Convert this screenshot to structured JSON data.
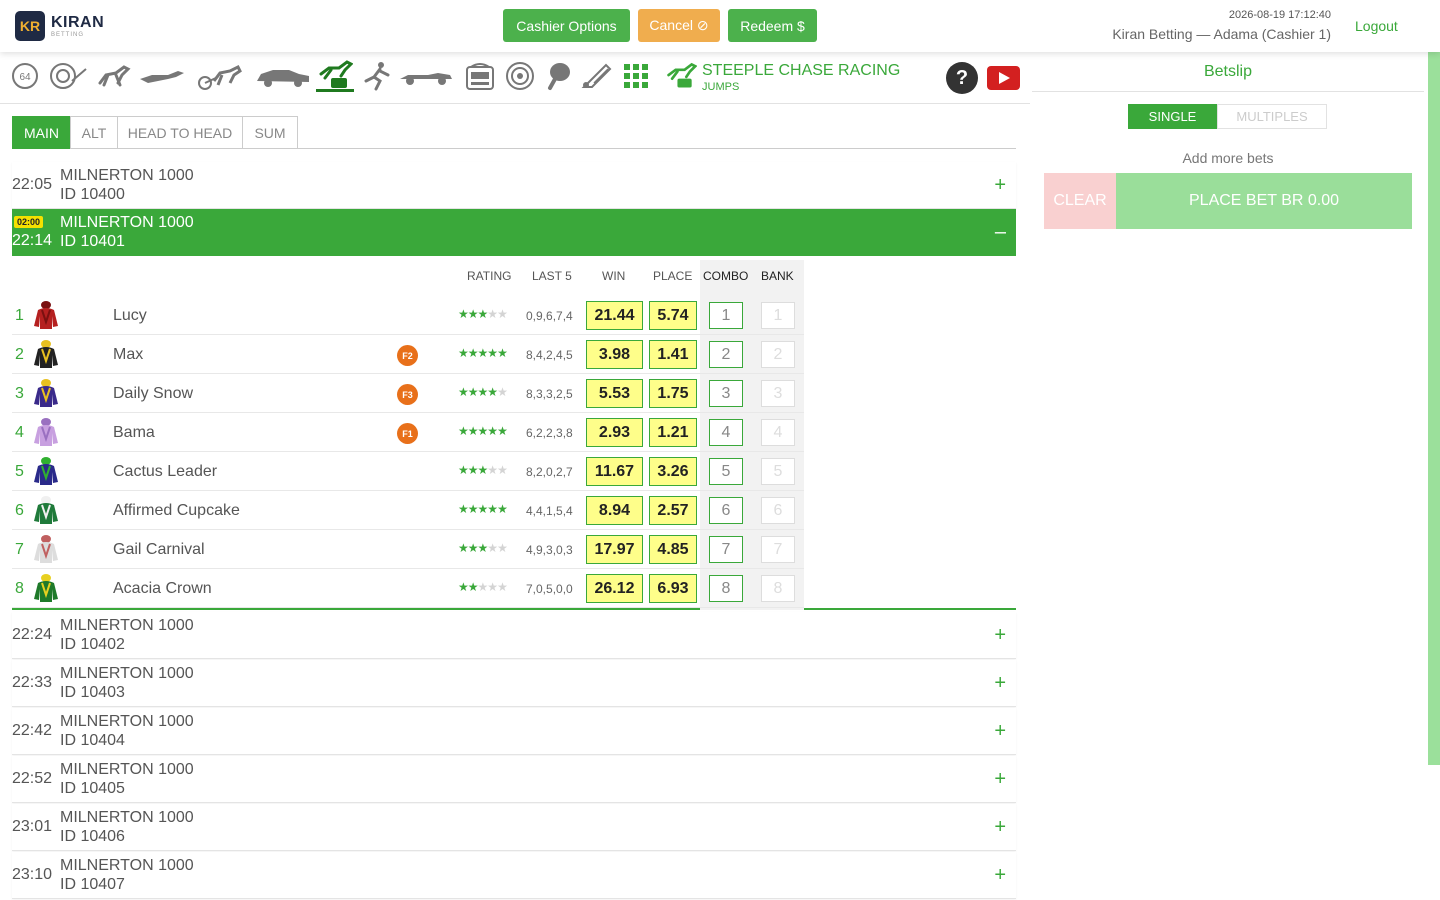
{
  "brand": {
    "badge": "KR",
    "name": "KIRAN",
    "sub": "BETTING"
  },
  "header": {
    "cashier_label": "Cashier Options",
    "cancel_label": "Cancel ⊘",
    "redeem_label": "Redeem $",
    "datetime": "2026-08-19 17:12:40",
    "user": "Kiran Betting — Adama (Cashier 1)",
    "logout_label": "Logout"
  },
  "sports": {
    "icons": [
      "keno-64-icon",
      "spin-wheel-icon",
      "horse-racing-icon",
      "dog-racing-icon",
      "harness-racing-icon",
      "motor-racing-icon",
      "steeple-chase-icon",
      "speed-skating-icon",
      "f1-racing-icon",
      "slot-machine-icon",
      "roulette-icon",
      "table-tennis-icon",
      "badminton-icon",
      "grid-icon"
    ],
    "active_title": "STEEPLE CHASE RACING",
    "active_sub": "JUMPS"
  },
  "tabs": [
    "MAIN",
    "ALT",
    "HEAD TO HEAD",
    "SUM"
  ],
  "races": [
    {
      "time": "22:05",
      "name": "MILNERTON 1000",
      "id": "ID 10400"
    },
    {
      "time": "22:14",
      "name": "MILNERTON 1000",
      "id": "ID 10401",
      "countdown": "02:00"
    },
    {
      "time": "22:24",
      "name": "MILNERTON 1000",
      "id": "ID 10402"
    },
    {
      "time": "22:33",
      "name": "MILNERTON 1000",
      "id": "ID 10403"
    },
    {
      "time": "22:42",
      "name": "MILNERTON 1000",
      "id": "ID 10404"
    },
    {
      "time": "22:52",
      "name": "MILNERTON 1000",
      "id": "ID 10405"
    },
    {
      "time": "23:01",
      "name": "MILNERTON 1000",
      "id": "ID 10406"
    },
    {
      "time": "23:10",
      "name": "MILNERTON 1000",
      "id": "ID 10407"
    }
  ],
  "expanded": {
    "columns": {
      "rating": "RATING",
      "last5": "LAST 5",
      "win": "WIN",
      "place": "PLACE",
      "combo": "COMBO",
      "bank": "BANK"
    },
    "runners": [
      {
        "num": "1",
        "name": "Lucy",
        "fav": "",
        "rating": 3,
        "last5": "0,9,6,7,4",
        "win": "21.44",
        "place": "5.74",
        "silk": [
          "#b52020",
          "#7a1010"
        ]
      },
      {
        "num": "2",
        "name": "Max",
        "fav": "F2",
        "rating": 5,
        "last5": "8,4,2,4,5",
        "win": "3.98",
        "place": "1.41",
        "silk": [
          "#222222",
          "#e8c020"
        ]
      },
      {
        "num": "3",
        "name": "Daily Snow",
        "fav": "F3",
        "rating": 4,
        "last5": "8,3,3,2,5",
        "win": "5.53",
        "place": "1.75",
        "silk": [
          "#3a2a8a",
          "#e8c020"
        ]
      },
      {
        "num": "4",
        "name": "Bama",
        "fav": "F1",
        "rating": 5,
        "last5": "6,2,2,3,8",
        "win": "2.93",
        "place": "1.21",
        "silk": [
          "#c8a0e0",
          "#9a70c0"
        ]
      },
      {
        "num": "5",
        "name": "Cactus Leader",
        "fav": "",
        "rating": 3,
        "last5": "8,2,0,2,7",
        "win": "11.67",
        "place": "3.26",
        "silk": [
          "#2a2a8a",
          "#30b030"
        ]
      },
      {
        "num": "6",
        "name": "Affirmed Cupcake",
        "fav": "",
        "rating": 5,
        "last5": "4,4,1,5,4",
        "win": "8.94",
        "place": "2.57",
        "silk": [
          "#1f7a3a",
          "#f0f0f0"
        ]
      },
      {
        "num": "7",
        "name": "Gail Carnival",
        "fav": "",
        "rating": 3,
        "last5": "4,9,3,0,3",
        "win": "17.97",
        "place": "4.85",
        "silk": [
          "#dddddd",
          "#c06060"
        ]
      },
      {
        "num": "8",
        "name": "Acacia Crown",
        "fav": "",
        "rating": 2,
        "last5": "7,0,5,0,0",
        "win": "26.12",
        "place": "6.93",
        "silk": [
          "#1f7a2a",
          "#e8d020"
        ]
      }
    ]
  },
  "betslip": {
    "title": "Betslip",
    "single_label": "SINGLE",
    "multiples_label": "MULTIPLES",
    "add_more": "Add more bets",
    "clear_label": "CLEAR",
    "place_label": "PLACE BET BR 0.00"
  },
  "colors": {
    "accent": "#3aa83a",
    "odds_bg": "#fefe8a",
    "cancel": "#f0ad4e",
    "fav_badge": "#e8701a"
  }
}
